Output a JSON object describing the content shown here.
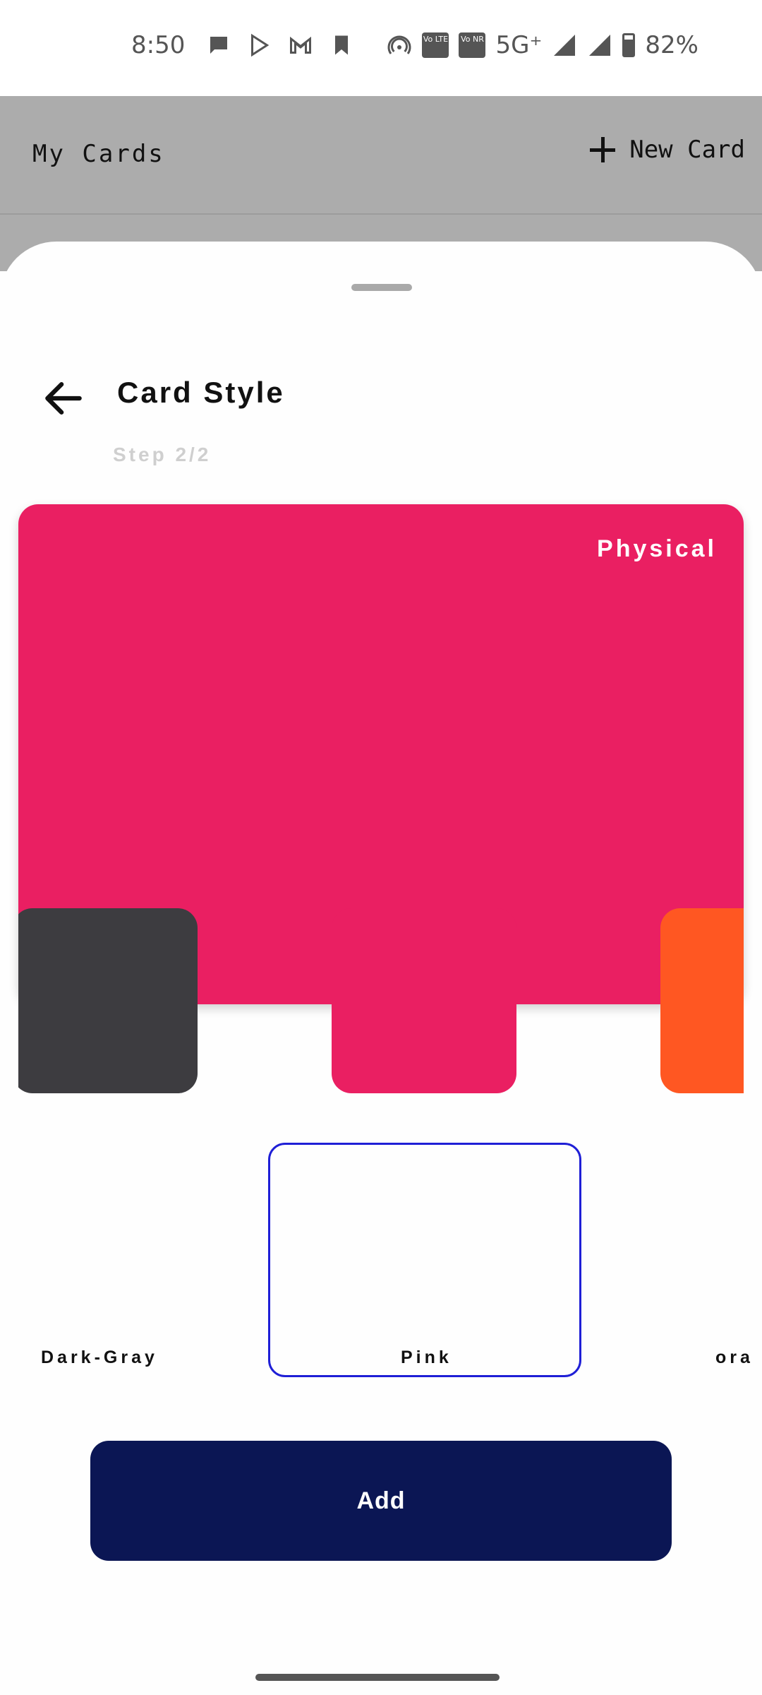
{
  "status_bar": {
    "time": "8:50",
    "network": "5G⁺",
    "battery": "82%",
    "left_icons": [
      "chat-bubble-icon",
      "play-store-icon",
      "gmail-icon",
      "bookmark-icon"
    ],
    "right_icons": [
      "hotspot-icon",
      "volte-icon",
      "vonr-icon",
      "signal-icon",
      "signal-icon",
      "battery-icon"
    ],
    "chip_vo_lte": "Vo LTE",
    "chip_vo_nr": "Vo NR"
  },
  "app_bar": {
    "title": "My Cards",
    "new_card_label": "New Card"
  },
  "sheet": {
    "title": "Card Style",
    "step": "Step 2/2"
  },
  "card_preview": {
    "type_label": "Physical",
    "color": "#ea1f62"
  },
  "colors": [
    {
      "label": "Dark-Gray",
      "hex": "#3d3c40",
      "selected": false
    },
    {
      "label": "Pink",
      "hex": "#ea1f62",
      "selected": true
    },
    {
      "label": "ora",
      "hex": "#ff5722",
      "selected": false
    }
  ],
  "actions": {
    "add_label": "Add"
  },
  "theme": {
    "primary": "#0b1654",
    "selection_border": "#1f1fd6",
    "scrim": "#acacac"
  }
}
